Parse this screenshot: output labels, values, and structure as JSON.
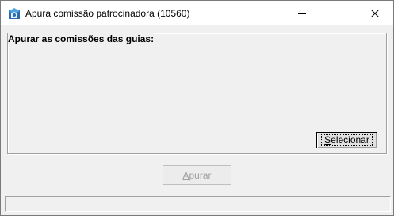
{
  "window": {
    "title": "Apura comissão patrocinadora (10560)",
    "icon": "app-icon"
  },
  "titlebar_buttons": {
    "minimize_icon": "minimize-icon",
    "maximize_icon": "maximize-icon",
    "close_icon": "close-icon"
  },
  "group": {
    "label": "Apurar as comissões das guias:",
    "select_button_label": "Selecionar"
  },
  "actions": {
    "apurar_label": "Apurar",
    "apurar_enabled": false
  },
  "status": {
    "text": ""
  }
}
